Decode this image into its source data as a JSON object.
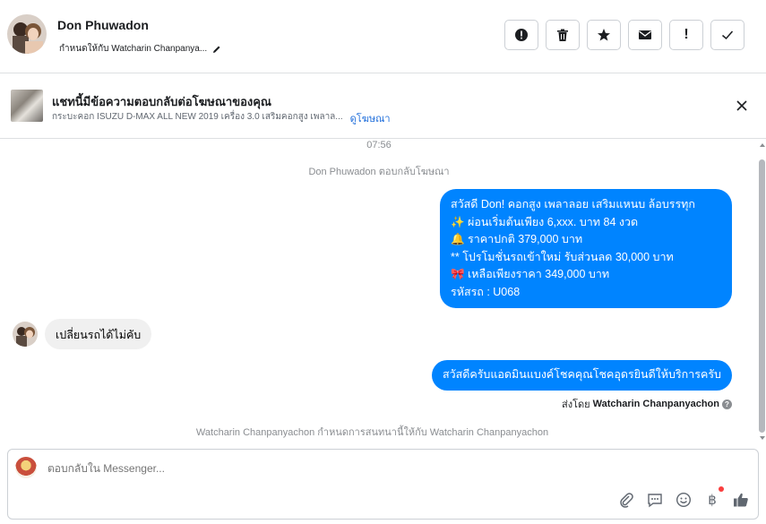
{
  "header": {
    "name": "Don Phuwadon",
    "assigned_text": "กำหนดให้กับ Watcharin Chanpanya...",
    "actions": [
      {
        "icon": "alert-circle-icon",
        "label": ""
      },
      {
        "icon": "trash-icon",
        "label": ""
      },
      {
        "icon": "star-icon",
        "label": ""
      },
      {
        "icon": "envelope-icon",
        "label": ""
      },
      {
        "icon": "exclamation-icon",
        "label": "!"
      },
      {
        "icon": "check-icon",
        "label": ""
      }
    ]
  },
  "ad": {
    "title": "แชทนี้มีข้อความตอบกลับต่อโฆษณาของคุณ",
    "subtitle": "กระบะคอก ISUZU D-MAX ALL NEW 2019 เครื่อง 3.0 เสริมคอกสูง เพลาล...",
    "link": "ดูโฆษณา"
  },
  "chat": {
    "timestamp": "07:56",
    "system_reply": "Don Phuwadon ตอบกลับโฆษณา",
    "ad_message_lines": [
      "สวัสดี Don! คอกสูง เพลาลอย เสริมแหนบ ล้อบรรทุก",
      "✨ ผ่อนเริ่มต้นเพียง 6,xxx. บาท 84 งวด",
      "🔔 ราคาปกติ 379,000 บาท",
      "** โปรโมชั่นรถเข้าใหม่ รับส่วนลด 30,000 บาท",
      "🎀 เหลือเพียงราคา 349,000 บาท",
      "รหัสรถ : U068"
    ],
    "incoming_message": "เปลี่ยนรถได้ไม่คับ",
    "outgoing_message": "สวัสดีครับแอดมินแบงค์โชคคุณโชคอุดรยินดีให้บริการครับ",
    "sent_by_prefix": "ส่งโดย",
    "sent_by_name": "Watcharin Chanpanyachon",
    "system_assign": "Watcharin Chanpanyachon กำหนดการสนทนานี้ให้กับ Watcharin Chanpanyachon"
  },
  "composer": {
    "placeholder": "ตอบกลับใน Messenger...",
    "tools": [
      "paperclip-icon",
      "saved-replies-icon",
      "emoji-icon",
      "baht-icon",
      "thumbs-up-icon"
    ],
    "baht_symbol": "฿"
  },
  "colors": {
    "outgoing_bubble": "#0084ff",
    "incoming_bubble": "#f0f0f0",
    "link": "#216fdb",
    "notification_dot": "#fa3e3e"
  }
}
